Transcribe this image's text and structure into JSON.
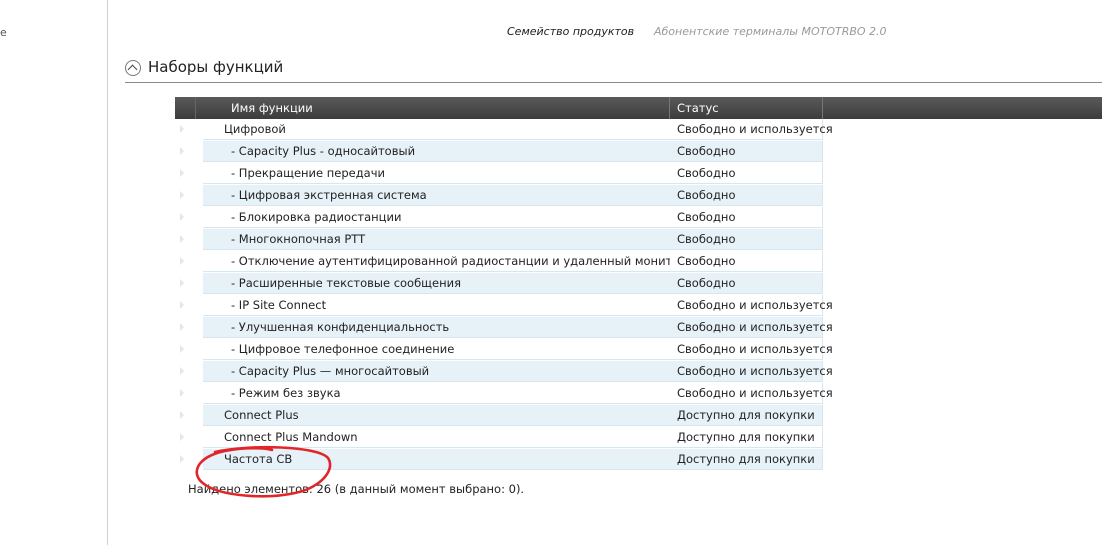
{
  "product_family": {
    "label": "Семейство продуктов",
    "value": "Абонентские терминалы MOTOTRBO 2.0"
  },
  "section": {
    "title": "Наборы функций"
  },
  "grid": {
    "columns": {
      "name": "Имя функции",
      "status": "Статус"
    },
    "rows": [
      {
        "name": "Цифровой",
        "status": "Свободно и используется"
      },
      {
        "name": "- Capacity Plus - односайтовый",
        "status": "Свободно"
      },
      {
        "name": "- Прекращение передачи",
        "status": "Свободно"
      },
      {
        "name": "- Цифровая экстренная система",
        "status": "Свободно"
      },
      {
        "name": "- Блокировка радиостанции",
        "status": "Свободно"
      },
      {
        "name": "- Многокнопочная PTT",
        "status": "Свободно"
      },
      {
        "name": "- Отключение аутентифицированной радиостанции и удаленный мониторинг",
        "status": "Свободно"
      },
      {
        "name": "- Расширенные текстовые сообщения",
        "status": "Свободно"
      },
      {
        "name": "- IP Site Connect",
        "status": "Свободно и используется"
      },
      {
        "name": "- Улучшенная конфиденциальность",
        "status": "Свободно и используется"
      },
      {
        "name": "- Цифровое телефонное соединение",
        "status": "Свободно и используется"
      },
      {
        "name": "- Capacity Plus — многосайтовый",
        "status": "Свободно и используется"
      },
      {
        "name": "- Режим без звука",
        "status": "Свободно и используется"
      },
      {
        "name": "Connect Plus",
        "status": "Доступно для покупки"
      },
      {
        "name": "Connect Plus Mandown",
        "status": "Доступно для покупки"
      },
      {
        "name": "Частота CB",
        "status": "Доступно для покупки"
      }
    ]
  },
  "footer": {
    "text": "Найдено элементов: 26 (в данный момент выбрано: 0)."
  },
  "annotation_color": "#e0262a"
}
